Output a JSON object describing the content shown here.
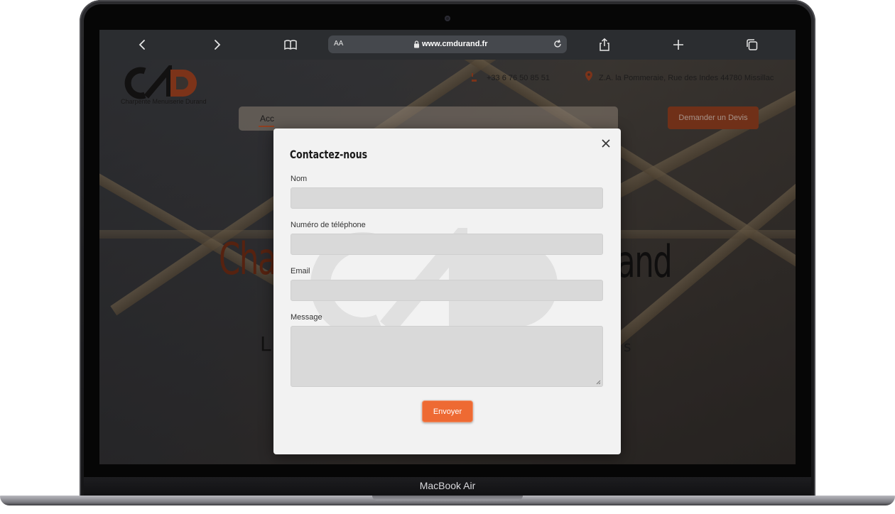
{
  "browser": {
    "aa_label": "AA",
    "url": "www.cmdurand.fr",
    "icons": [
      "back-icon",
      "forward-icon",
      "bookmarks-icon",
      "lock-icon",
      "reload-icon",
      "share-icon",
      "new-tab-icon",
      "tabs-icon"
    ]
  },
  "site": {
    "logo_caption": "Charpente Menuiserie Durand",
    "phone": "+33 6 76 50 85 51",
    "address": "Z.A. la Pommeraie, Rue des Indes 44780 Missillac",
    "nav_partial": "Acc",
    "devis_button": "Demander un Devis",
    "hero_partial_left": "Cha",
    "hero_partial_right": "and",
    "subtitle_partial_left": "L",
    "subtitle_partial_right": "s"
  },
  "modal": {
    "title": "Contactez-nous",
    "fields": [
      {
        "label": "Nom",
        "value": ""
      },
      {
        "label": "Numéro de téléphone",
        "value": ""
      },
      {
        "label": "Email",
        "value": ""
      },
      {
        "label": "Message",
        "value": ""
      }
    ],
    "submit_label": "Envoyer"
  },
  "device": {
    "label": "MacBook Air"
  },
  "colors": {
    "accent": "#ee6a33",
    "brand_dark_orange": "#a1411d",
    "toolbar": "#2b2d30"
  }
}
